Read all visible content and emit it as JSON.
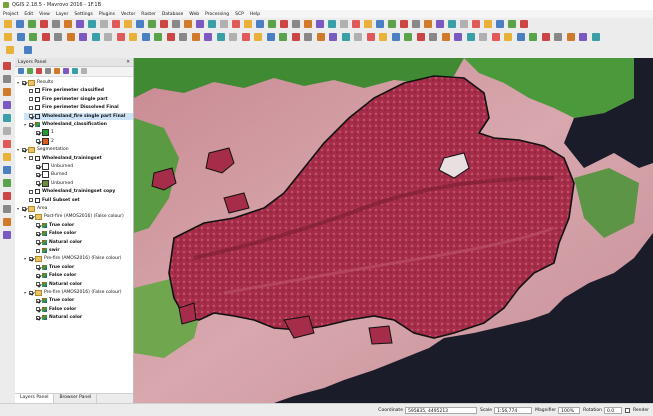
{
  "window": {
    "title": "QGIS 2.18.5 - Mavrovo 2016 - 1F.1B"
  },
  "menu": [
    "Project",
    "Edit",
    "View",
    "Layer",
    "Settings",
    "Plugins",
    "Vector",
    "Raster",
    "Database",
    "Web",
    "Processing",
    "SCP",
    "Help"
  ],
  "layers_panel": {
    "title": "Layers Panel",
    "close_glyph": "✕",
    "items": [
      {
        "label": "Results",
        "kind": "group",
        "bold": false,
        "checked": true,
        "expanded": true,
        "indent": 0
      },
      {
        "label": "Fire perimeter classified",
        "kind": "vector",
        "bold": true,
        "checked": false,
        "indent": 1
      },
      {
        "label": "Fire perimeter single part",
        "kind": "vector",
        "bold": true,
        "checked": false,
        "indent": 1
      },
      {
        "label": "Fire perimeter Dissolved Final",
        "kind": "vector",
        "bold": true,
        "checked": false,
        "indent": 1
      },
      {
        "label": "Wholesland_fire single part Final",
        "kind": "vector",
        "bold": true,
        "checked": true,
        "selected": true,
        "indent": 1
      },
      {
        "label": "Wholesland_classification",
        "kind": "raster",
        "bold": true,
        "checked": true,
        "expanded": true,
        "indent": 1
      },
      {
        "label": "1",
        "kind": "swatch",
        "color": "#1f9e2f",
        "checked": true,
        "indent": 2
      },
      {
        "label": "2",
        "kind": "swatch",
        "color": "#e05a1a",
        "checked": true,
        "indent": 2
      },
      {
        "label": "Segmentation",
        "kind": "group",
        "bold": false,
        "checked": true,
        "expanded": true,
        "indent": 0
      },
      {
        "label": "Wholesland_trainingset",
        "kind": "vector",
        "bold": true,
        "checked": false,
        "expanded": true,
        "indent": 1
      },
      {
        "label": "Unburned",
        "kind": "swatch",
        "color": "#ffffff",
        "checked": true,
        "indent": 2
      },
      {
        "label": "Burned",
        "kind": "swatch",
        "color": "#ffffff",
        "checked": true,
        "indent": 2
      },
      {
        "label": "Unburned",
        "kind": "swatch",
        "color": "#6b8e3a",
        "checked": true,
        "indent": 2
      },
      {
        "label": "Wholesland_trainingset copy",
        "kind": "vector",
        "bold": true,
        "checked": false,
        "indent": 1
      },
      {
        "label": "Full Subset set",
        "kind": "vector",
        "bold": true,
        "checked": false,
        "indent": 1
      },
      {
        "label": "Area",
        "kind": "group",
        "bold": false,
        "checked": true,
        "expanded": true,
        "indent": 0
      },
      {
        "label": "Post-fire (AMOS2016) (False colour)",
        "kind": "group",
        "bold": false,
        "checked": true,
        "expanded": true,
        "indent": 1
      },
      {
        "label": "True color",
        "kind": "raster",
        "bold": true,
        "checked": true,
        "indent": 2
      },
      {
        "label": "False color",
        "kind": "raster",
        "bold": true,
        "checked": true,
        "indent": 2
      },
      {
        "label": "Natural color",
        "kind": "raster",
        "bold": true,
        "checked": true,
        "indent": 2
      },
      {
        "label": "swir",
        "kind": "raster",
        "bold": true,
        "checked": false,
        "indent": 2
      },
      {
        "label": "Pre-fire (AMOS2016) (False colour)",
        "kind": "group",
        "bold": false,
        "checked": true,
        "expanded": true,
        "indent": 1
      },
      {
        "label": "True color",
        "kind": "raster",
        "bold": true,
        "checked": true,
        "indent": 2
      },
      {
        "label": "False color",
        "kind": "raster",
        "bold": true,
        "checked": true,
        "indent": 2
      },
      {
        "label": "Natural color",
        "kind": "raster",
        "bold": true,
        "checked": true,
        "indent": 2
      },
      {
        "label": "Pre-fire (AMOS2016) (False colour)",
        "kind": "group",
        "bold": false,
        "checked": true,
        "expanded": true,
        "indent": 1
      },
      {
        "label": "True color",
        "kind": "raster",
        "bold": true,
        "checked": true,
        "indent": 2
      },
      {
        "label": "False color",
        "kind": "raster",
        "bold": true,
        "checked": true,
        "indent": 2
      },
      {
        "label": "Natural color",
        "kind": "raster",
        "bold": true,
        "checked": true,
        "indent": 2
      }
    ],
    "tabs": [
      "Layers Panel",
      "Browser Panel"
    ]
  },
  "statusbar": {
    "coordinate_label": "Coordinate",
    "coordinate_value": "595835, 4495213",
    "scale_label": "Scale",
    "scale_value": "1:56,774",
    "magnifier_label": "Magnifier",
    "magnifier_value": "100%",
    "rotation_label": "Rotation",
    "rotation_value": "0.0",
    "render_label": "Render"
  },
  "colors": {
    "burn_fill": "#b0334f",
    "burn_outline": "#111111",
    "vegetation": "#3f8a33",
    "bare_land": "#d9aeb4",
    "sea": "#1a1c2a",
    "selected_row": "#cde3f7"
  }
}
